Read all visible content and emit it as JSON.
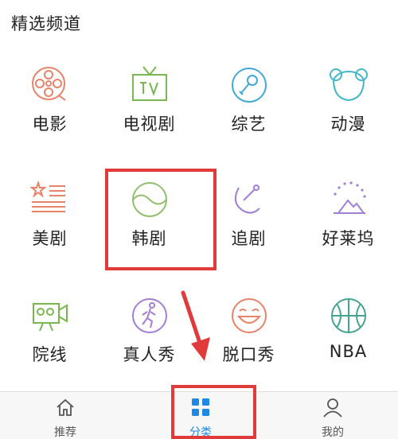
{
  "section": {
    "title": "精选频道"
  },
  "channels": [
    {
      "label": "电影",
      "icon": "film-reel-icon",
      "color": "#e8836b"
    },
    {
      "label": "电视剧",
      "icon": "tv-icon",
      "color": "#78b84f"
    },
    {
      "label": "综艺",
      "icon": "microphone-icon",
      "color": "#3fa9d6"
    },
    {
      "label": "动漫",
      "icon": "bear-head-icon",
      "color": "#45b8c8"
    },
    {
      "label": "美剧",
      "icon": "us-flag-icon",
      "color": "#e8836b"
    },
    {
      "label": "韩剧",
      "icon": "korea-taeguk-icon",
      "color": "#8fbf6a"
    },
    {
      "label": "追剧",
      "icon": "satellite-dish-icon",
      "color": "#a17fd6"
    },
    {
      "label": "好莱坞",
      "icon": "hollywood-mountain-icon",
      "color": "#a17fd6"
    },
    {
      "label": "院线",
      "icon": "movie-camera-icon",
      "color": "#78b84f"
    },
    {
      "label": "真人秀",
      "icon": "runner-icon",
      "color": "#a17fd6"
    },
    {
      "label": "脱口秀",
      "icon": "laughing-face-icon",
      "color": "#e8836b"
    },
    {
      "label": "NBA",
      "icon": "basketball-icon",
      "color": "#45a38f"
    }
  ],
  "tabbar": {
    "tabs": [
      {
        "label": "推荐",
        "icon": "home-icon",
        "active": false
      },
      {
        "label": "分类",
        "icon": "grid-icon",
        "active": true
      },
      {
        "label": "我的",
        "icon": "person-icon",
        "active": false
      }
    ]
  },
  "colors": {
    "highlight": "#e03a3a",
    "accent": "#1e88e5"
  }
}
